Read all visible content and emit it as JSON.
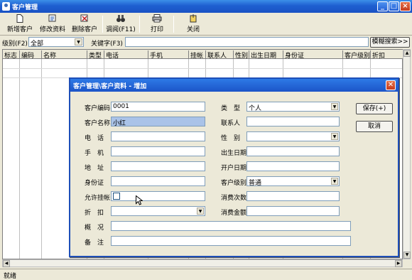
{
  "window": {
    "title": "客户管理",
    "min_glyph": "_",
    "max_glyph": "□",
    "close_glyph": "×"
  },
  "toolbar": {
    "new": "新增客户",
    "edit": "修改资料",
    "delete": "删除客户",
    "lookup": "调阅(F11)",
    "print": "打印",
    "close": "关闭",
    "new_icon": "document-icon",
    "edit_icon": "edit-icon",
    "delete_icon": "delete-icon",
    "lookup_icon": "binoculars-icon",
    "print_icon": "printer-icon",
    "close_icon": "exit-icon"
  },
  "filter": {
    "level_label": "级别(F2)",
    "level_value": "全部",
    "keyword_label": "关键字(F3)",
    "keyword_value": "",
    "fuzzy_search": "模糊搜索>>"
  },
  "grid": {
    "columns": [
      "标志",
      "编码",
      "名称",
      "类型",
      "电话",
      "手机",
      "挂帐",
      "联系人",
      "性别",
      "出生日期",
      "身份证",
      "客户级别",
      "折扣"
    ]
  },
  "status": {
    "text": "就绪"
  },
  "dialog": {
    "title": "客户管理\\客户资料 - 增加",
    "save": "保存(+)",
    "cancel": "取消",
    "left": {
      "code_label": "客户编码",
      "code_value": "0001",
      "name_label": "客户名称",
      "name_value": "小红",
      "phone_label": "电　话",
      "phone_value": "",
      "mobile_label": "手　机",
      "mobile_value": "",
      "address_label": "地　址",
      "address_value": "",
      "id_label": "身份证",
      "id_value": "",
      "credit_label": "允许挂帐",
      "credit_checked": false,
      "discount_label": "折　扣",
      "discount_value": "",
      "overview_label": "概　况",
      "overview_value": "",
      "remark_label": "备　注",
      "remark_value": ""
    },
    "right": {
      "type_label": "类　型",
      "type_value": "个人",
      "contact_label": "联系人",
      "contact_value": "",
      "gender_label": "性　别",
      "gender_value": "",
      "birth_label": "出生日期",
      "birth_value": "",
      "open_label": "开户日期",
      "open_value": "",
      "level_label": "客户级别",
      "level_value": "普通",
      "count_label": "消费次数",
      "count_value": "",
      "amount_label": "消费金额",
      "amount_value": ""
    }
  },
  "colors": {
    "title_blue": "#1e5fd0",
    "selected_field": "#aac3e8",
    "close_red": "#c63b1d"
  }
}
